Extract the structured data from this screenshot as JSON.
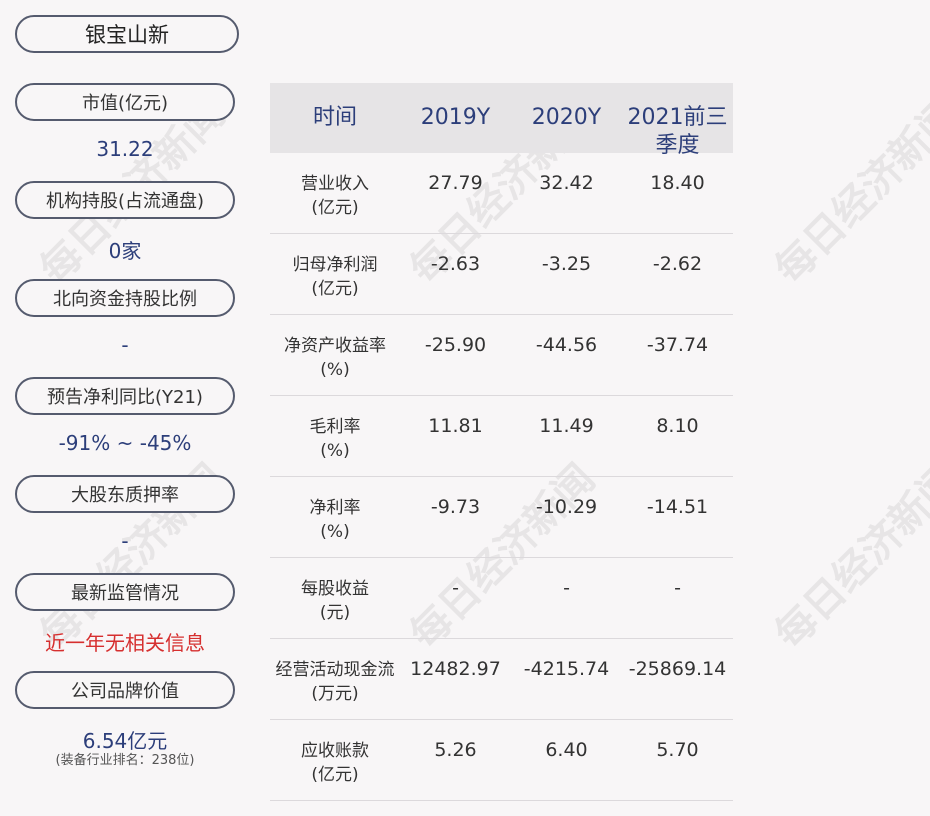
{
  "title": "银宝山新",
  "watermark": "每日经济新闻",
  "left_panel": [
    {
      "label": "市值(亿元)",
      "value": "31.22"
    },
    {
      "label": "机构持股(占流通盘)",
      "value": "0家"
    },
    {
      "label": "北向资金持股比例",
      "value": "-"
    },
    {
      "label": "预告净利同比(Y21)",
      "value": "-91% ~ -45%"
    },
    {
      "label": "大股东质押率",
      "value": "-"
    },
    {
      "label": "最新监管情况",
      "value": "近一年无相关信息"
    },
    {
      "label": "公司品牌价值",
      "value": "6.54亿元",
      "note": "(装备行业排名：238位)"
    }
  ],
  "table": {
    "headers": [
      "时间",
      "2019Y",
      "2020Y",
      "2021前三季度"
    ],
    "rows": [
      {
        "label": [
          "营业收入",
          "(亿元)"
        ],
        "values": [
          "27.79",
          "32.42",
          "18.40"
        ]
      },
      {
        "label": [
          "归母净利润",
          "(亿元)"
        ],
        "values": [
          "-2.63",
          "-3.25",
          "-2.62"
        ]
      },
      {
        "label": [
          "净资产收益率",
          "(%)"
        ],
        "values": [
          "-25.90",
          "-44.56",
          "-37.74"
        ]
      },
      {
        "label": [
          "毛利率",
          "(%)"
        ],
        "values": [
          "11.81",
          "11.49",
          "8.10"
        ]
      },
      {
        "label": [
          "净利率",
          "(%)"
        ],
        "values": [
          "-9.73",
          "-10.29",
          "-14.51"
        ]
      },
      {
        "label": [
          "每股收益",
          "(元)"
        ],
        "values": [
          "-",
          "-",
          "-"
        ]
      },
      {
        "label": [
          "经营活动现金流",
          "(万元)"
        ],
        "values": [
          "12482.97",
          "-4215.74",
          "-25869.14"
        ]
      },
      {
        "label": [
          "应收账款",
          "(亿元)"
        ],
        "values": [
          "5.26",
          "6.40",
          "5.70"
        ]
      }
    ]
  }
}
